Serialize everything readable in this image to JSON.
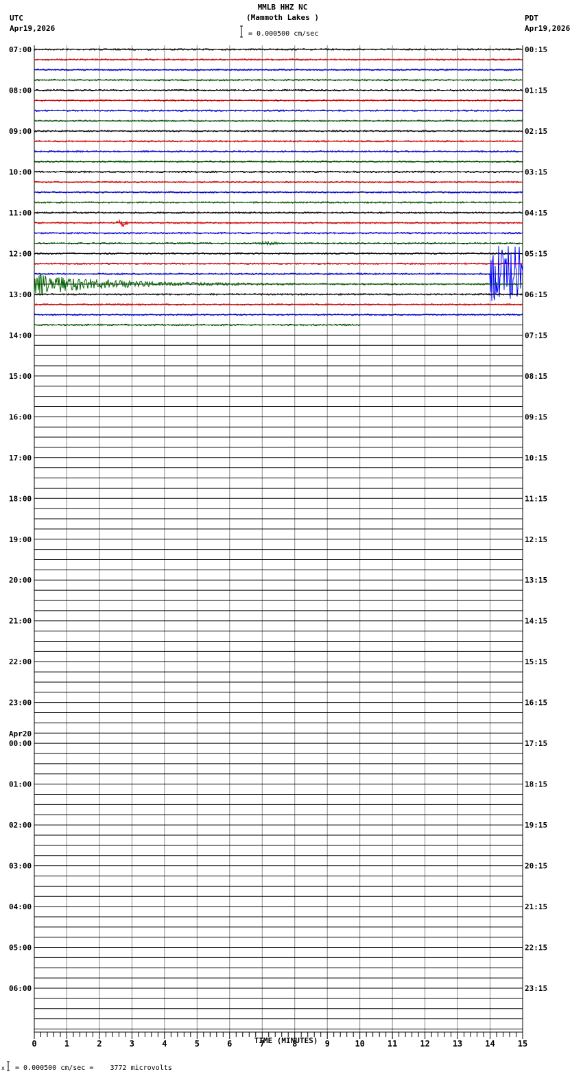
{
  "chart_data": {
    "type": "line",
    "title": "MMLB HHZ NC",
    "subtitle": "(Mammoth Lakes )",
    "left_timezone": "UTC",
    "left_date": "Apr19,2026",
    "right_timezone": "PDT",
    "right_date": "Apr19,2026",
    "scale_label": "= 0.000500 cm/sec",
    "xlabel": "TIME (MINUTES)",
    "xlim": [
      0,
      15
    ],
    "x_ticks": [
      "0",
      "1",
      "2",
      "3",
      "4",
      "5",
      "6",
      "7",
      "8",
      "9",
      "10",
      "11",
      "12",
      "13",
      "14",
      "15"
    ],
    "rows_per_hour": 4,
    "total_rows": 96,
    "trace_colors": [
      "#000000",
      "#ff0000",
      "#0000ff",
      "#006400"
    ],
    "left_hour_labels": [
      "07:00",
      "08:00",
      "09:00",
      "10:00",
      "11:00",
      "12:00",
      "13:00",
      "14:00",
      "15:00",
      "16:00",
      "17:00",
      "18:00",
      "19:00",
      "20:00",
      "21:00",
      "22:00",
      "23:00",
      "00:00",
      "01:00",
      "02:00",
      "03:00",
      "04:00",
      "05:00",
      "06:00"
    ],
    "date_change_label": "Apr20",
    "right_hour_labels": [
      "00:15",
      "01:15",
      "02:15",
      "03:15",
      "04:15",
      "05:15",
      "06:15",
      "07:15",
      "08:15",
      "09:15",
      "10:15",
      "11:15",
      "12:15",
      "13:15",
      "14:15",
      "15:15",
      "16:15",
      "17:15",
      "18:15",
      "19:15",
      "20:15",
      "21:15",
      "22:15",
      "23:15"
    ],
    "data_end": {
      "row": 27,
      "minute": 10
    },
    "events": [
      {
        "row": 17,
        "start_minute": 2.5,
        "duration_minutes": 0.4,
        "amplitude": 5
      },
      {
        "row": 19,
        "start_minute": 6.9,
        "duration_minutes": 0.6,
        "amplitude": 2.5
      },
      {
        "row": 22,
        "start_minute": 14.0,
        "duration_minutes": 1.0,
        "amplitude": 40
      },
      {
        "row": 23,
        "start_minute": 0.0,
        "duration_minutes": 8.0,
        "amplitude": 16
      }
    ],
    "footer": "= 0.000500 cm/sec =    3772 microvolts"
  }
}
